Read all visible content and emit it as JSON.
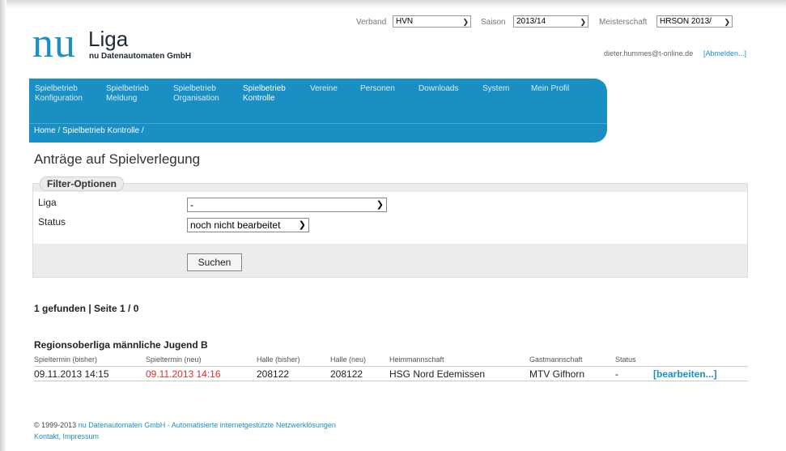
{
  "header": {
    "logo_nu": "nu",
    "logo_liga": "Liga",
    "logo_sub": "nu Datenautomaten GmbH",
    "verband_label": "Verband",
    "verband_value": "HVN",
    "saison_label": "Saison",
    "saison_value": "2013/14",
    "meisterschaft_label": "Meisterschaft",
    "meisterschaft_value": "HRSON 2013/",
    "user_email": "dieter.hummes@t-online.de",
    "logout": "[Abmelden...]"
  },
  "nav": {
    "items": [
      {
        "line1": "Spielbetrieb",
        "line2": "Konfiguration"
      },
      {
        "line1": "Spielbetrieb",
        "line2": "Meldung"
      },
      {
        "line1": "Spielbetrieb",
        "line2": "Organisation"
      },
      {
        "line1": "Spielbetrieb",
        "line2": "Kontrolle"
      },
      {
        "line1": "Vereine",
        "line2": ""
      },
      {
        "line1": "Personen",
        "line2": ""
      },
      {
        "line1": "Downloads",
        "line2": ""
      },
      {
        "line1": "System",
        "line2": ""
      },
      {
        "line1": "Mein Profil",
        "line2": ""
      }
    ],
    "breadcrumb": "Home / Spielbetrieb Kontrolle /"
  },
  "main": {
    "title": "Anträge auf Spielverlegung",
    "filter": {
      "legend": "Filter-Optionen",
      "liga_label": "Liga",
      "liga_value": "-",
      "status_label": "Status",
      "status_value": "noch nicht bearbeitet",
      "search_button": "Suchen"
    },
    "result_count": "1 gefunden | Seite 1 / 0",
    "league": "Regionsoberliga männliche Jugend B",
    "columns": [
      "Spieltermin (bisher)",
      "Spieltermin (neu)",
      "Halle (bisher)",
      "Halle (neu)",
      "Heimmannschaft",
      "Gastmannschaft",
      "Status"
    ],
    "row": {
      "termin_bisher": "09.11.2013 14:15",
      "termin_neu": "09.11.2013 14:16",
      "halle_bisher": "208122",
      "halle_neu": "208122",
      "heim": "HSG Nord Edemissen",
      "gast": "MTV Gifhorn",
      "status": "-",
      "action": "[bearbeiten...]"
    }
  },
  "footer": {
    "copyright": "© 1999-2013",
    "company_link": "nu Datenautomaten GmbH - Automatisierte internetgestützte Netzwerklösungen",
    "links": "Kontakt, Impressum"
  },
  "colors": {
    "accent": "#1a8fc4",
    "changed_date": "#d9302b"
  }
}
